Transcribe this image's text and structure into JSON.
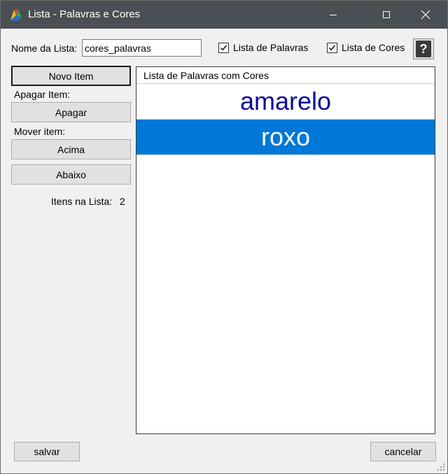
{
  "window": {
    "title": "Lista - Palavras e Cores",
    "titlebar_color": "#494f52"
  },
  "form": {
    "name_label": "Nome da Lista:",
    "name_value": "cores_palavras",
    "words_checkbox_label": "Lista de Palavras",
    "words_checked": true,
    "colors_checkbox_label": "Lista de Cores",
    "colors_checked": true,
    "help_label": "?"
  },
  "sidebar": {
    "new_item_label": "Novo Item",
    "delete_group_label": "Apagar Item:",
    "delete_label": "Apagar",
    "move_group_label": "Mover item:",
    "up_label": "Acima",
    "down_label": "Abaixo",
    "count_label": "Itens na Lista:",
    "count_value": "2"
  },
  "list": {
    "header": "Lista de Palavras com Cores",
    "items": [
      {
        "text": "amarelo",
        "color": "#0c0c9a",
        "selected": false
      },
      {
        "text": "roxo",
        "color": "#ffffff",
        "selected": true
      }
    ],
    "selection_color": "#0078d7"
  },
  "footer": {
    "save_label": "salvar",
    "cancel_label": "cancelar"
  }
}
